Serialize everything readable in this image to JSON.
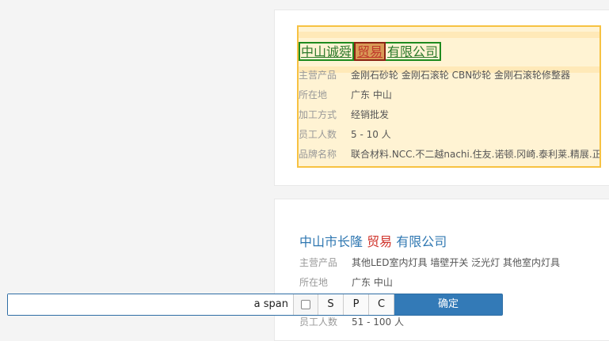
{
  "card1": {
    "title_parts": [
      "中山诚舜",
      "贸易",
      "有限公司"
    ],
    "rows": [
      {
        "label": "主营产品",
        "value": "金刚石砂轮 金刚石滚轮 CBN砂轮 金刚石滚轮修整器"
      },
      {
        "label": "所在地",
        "value": "广东 中山"
      },
      {
        "label": "加工方式",
        "value": "经销批发"
      },
      {
        "label": "员工人数",
        "value": "5 - 10 人"
      },
      {
        "label": "品牌名称",
        "value": "联合材料.NCC.不二越nachi.住友.诺顿.冈崎.泰利莱.精展.正河"
      }
    ]
  },
  "card2": {
    "title_parts": [
      "中山市长隆 ",
      "贸易",
      " 有限公司"
    ],
    "rows": [
      {
        "label": "主营产品",
        "value": "其他LED室内灯具 墙壁开关 泛光灯 其他室内灯具"
      },
      {
        "label": "所在地",
        "value": "广东 中山"
      },
      {
        "label": "员工人数",
        "value": "51 - 100 人"
      }
    ]
  },
  "toolbar": {
    "text_value": "a span",
    "btn_s": "S",
    "btn_p": "P",
    "btn_c": "C",
    "confirm": "确定"
  }
}
